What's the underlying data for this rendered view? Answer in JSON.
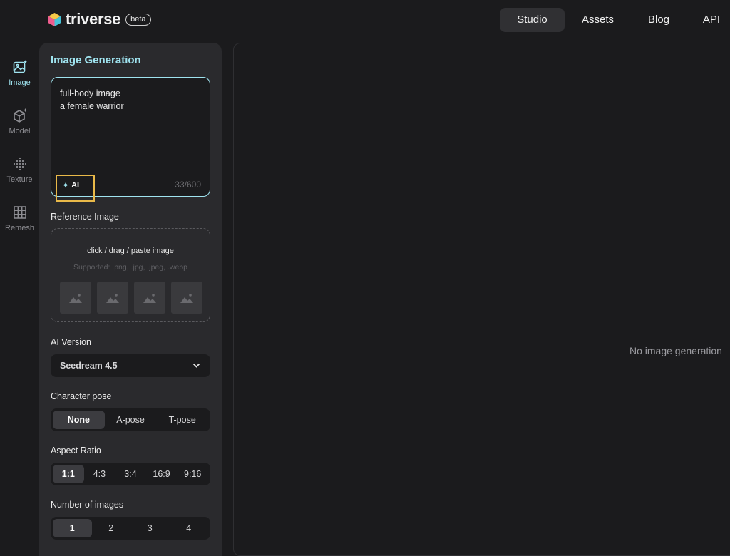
{
  "brand": {
    "name": "triverse",
    "badge": "beta"
  },
  "topnav": [
    {
      "label": "Studio",
      "active": true
    },
    {
      "label": "Assets",
      "active": false
    },
    {
      "label": "Blog",
      "active": false
    },
    {
      "label": "API",
      "active": false
    }
  ],
  "rail": [
    {
      "label": "Image",
      "icon": "image-sparkle-icon",
      "active": true
    },
    {
      "label": "Model",
      "icon": "cube-sparkle-icon",
      "active": false
    },
    {
      "label": "Texture",
      "icon": "texture-dots-icon",
      "active": false
    },
    {
      "label": "Remesh",
      "icon": "grid-icon",
      "active": false
    }
  ],
  "panel": {
    "title": "Image Generation",
    "prompt": {
      "value": "full-body image\na female warrior",
      "counter": "33/600",
      "ai_label": "AI"
    },
    "reference": {
      "label": "Reference Image",
      "hint": "click / drag / paste image",
      "supported": "Supported: .png, .jpg, .jpeg, .webp"
    },
    "ai_version": {
      "label": "AI Version",
      "selected": "Seedream 4.5"
    },
    "pose": {
      "label": "Character pose",
      "options": [
        "None",
        "A-pose",
        "T-pose"
      ],
      "selected": "None"
    },
    "aspect": {
      "label": "Aspect Ratio",
      "options": [
        "1:1",
        "4:3",
        "3:4",
        "16:9",
        "9:16"
      ],
      "selected": "1:1"
    },
    "count": {
      "label": "Number of images",
      "options": [
        "1",
        "2",
        "3",
        "4"
      ],
      "selected": "1"
    }
  },
  "canvas": {
    "empty_text": "No image generation"
  },
  "colors": {
    "accent": "#9fe3ef",
    "highlight": "#e9b949",
    "background": "#1b1b1d",
    "panel": "#2a2a2d"
  }
}
